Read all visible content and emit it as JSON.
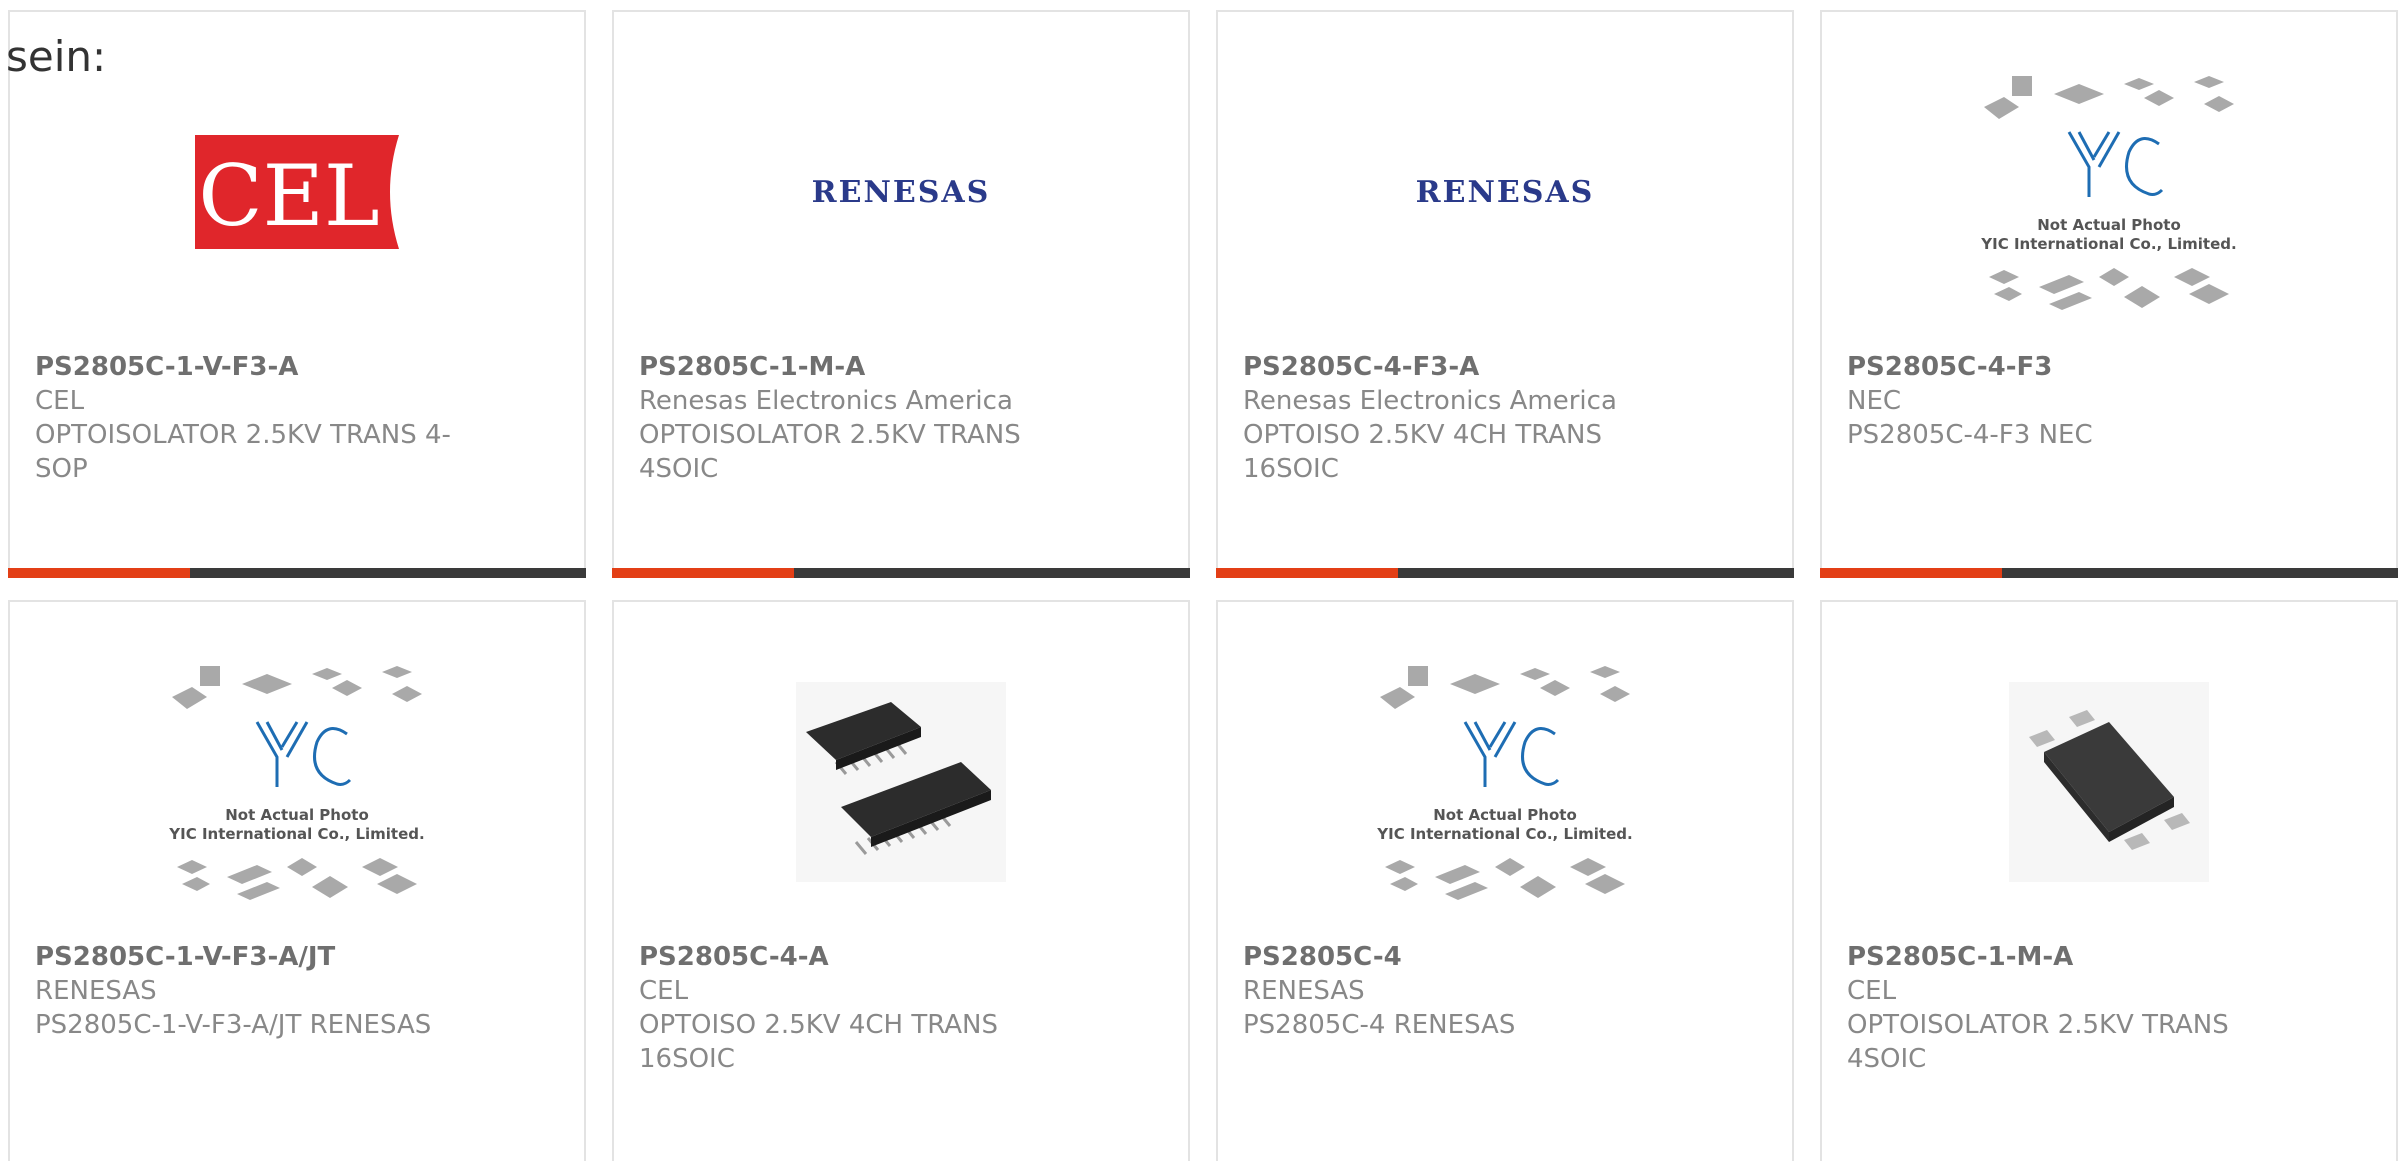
{
  "lead_text": "sein:",
  "products": [
    {
      "image": "cel-logo",
      "part_number": "PS2805C-1-V-F3-A",
      "manufacturer": "CEL",
      "description": "OPTOISOLATOR 2.5KV TRANS 4-SOP"
    },
    {
      "image": "renesas-logo",
      "part_number": "PS2805C-1-M-A",
      "manufacturer": "Renesas Electronics America",
      "description": "OPTOISOLATOR 2.5KV TRANS 4SOIC"
    },
    {
      "image": "renesas-logo",
      "part_number": "PS2805C-4-F3-A",
      "manufacturer": "Renesas Electronics America",
      "description": "OPTOISO 2.5KV 4CH TRANS 16SOIC"
    },
    {
      "image": "yic-placeholder",
      "part_number": "PS2805C-4-F3",
      "manufacturer": "NEC",
      "description": "PS2805C-4-F3 NEC"
    },
    {
      "image": "yic-placeholder",
      "part_number": "PS2805C-1-V-F3-A/JT",
      "manufacturer": "RENESAS",
      "description": "PS2805C-1-V-F3-A/JT RENESAS"
    },
    {
      "image": "ic-chip-photo",
      "part_number": "PS2805C-4-A",
      "manufacturer": "CEL",
      "description": "OPTOISO 2.5KV 4CH TRANS 16SOIC"
    },
    {
      "image": "yic-placeholder",
      "part_number": "PS2805C-4",
      "manufacturer": "RENESAS",
      "description": "PS2805C-4 RENESAS"
    },
    {
      "image": "sop-chip-photo",
      "part_number": "PS2805C-1-M-A",
      "manufacturer": "CEL",
      "description": "OPTOISOLATOR 2.5KV TRANS 4SOIC"
    }
  ],
  "logos": {
    "cel": "CEL",
    "renesas": "RENESAS",
    "yic_mark": "YIC",
    "yic_line1": "Not Actual Photo",
    "yic_line2": "YIC International Co., Limited."
  },
  "colors": {
    "accent": "#e33f16",
    "bar": "#3a3a3a",
    "cel_red": "#e0262b",
    "renesas_blue": "#2a3a8a",
    "yic_blue": "#1e6db3"
  }
}
